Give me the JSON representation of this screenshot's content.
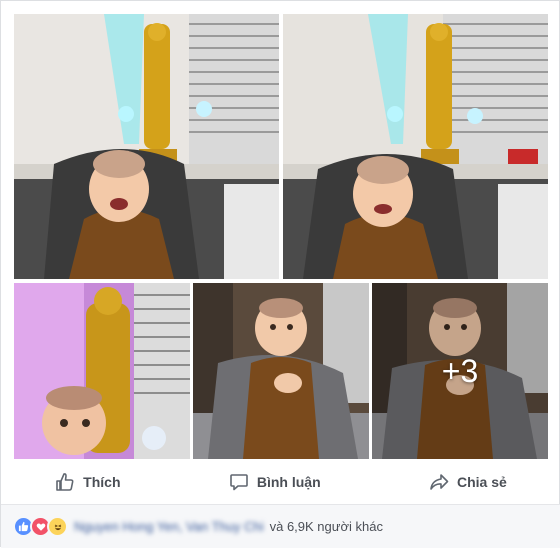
{
  "photos": {
    "more_count": "+3"
  },
  "actions": {
    "like_label": "Thích",
    "comment_label": "Bình luận",
    "share_label": "Chia sẻ"
  },
  "reactions": {
    "names": "Nguyen Hong Yen, Van Thuy Chi",
    "others": "và 6,9K người khác",
    "icons": [
      "like-icon",
      "love-icon",
      "haha-icon"
    ],
    "colors": {
      "like": "#5890ff",
      "love": "#f25268",
      "haha": "#fcd35a"
    }
  },
  "colors": {
    "action_text": "#4b4f56",
    "name_link": "#365899",
    "footer_bg": "#f6f7f9"
  }
}
